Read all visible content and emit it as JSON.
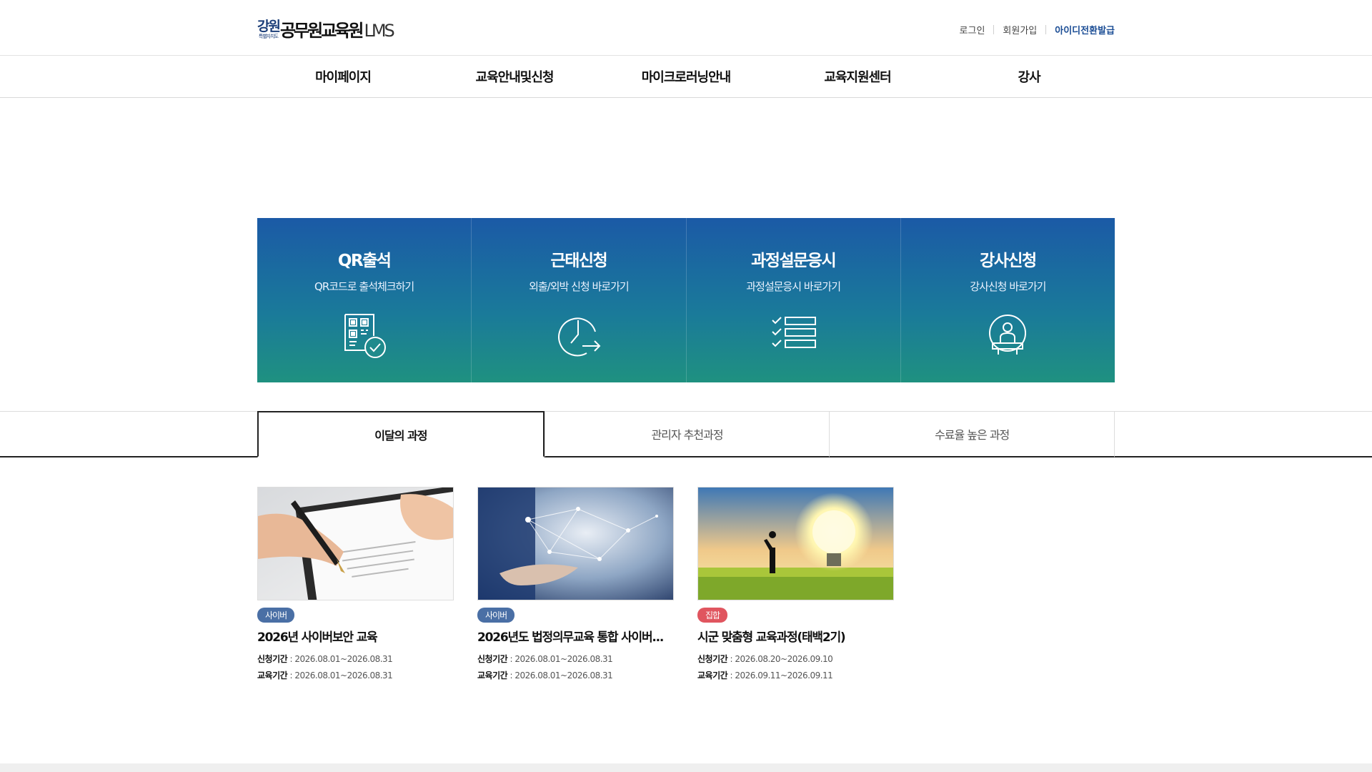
{
  "header": {
    "logo": {
      "seal_main": "강원",
      "seal_sub": "특별자치도",
      "name": "공무원교육원",
      "suffix": "LMS"
    },
    "util": {
      "login": "로그인",
      "join": "회원가입",
      "id_convert": "아이디전환발급"
    }
  },
  "gnb": [
    "마이페이지",
    "교육안내및신청",
    "마이크로러닝안내",
    "교육지원센터",
    "강사"
  ],
  "quick": [
    {
      "title": "QR출석",
      "sub": "QR코드로 출석체크하기",
      "icon": "qr-check-icon"
    },
    {
      "title": "근태신청",
      "sub": "외출/외박 신청 바로가기",
      "icon": "clock-arrow-icon"
    },
    {
      "title": "과정설문응시",
      "sub": "과정설문응시 바로가기",
      "icon": "checklist-icon"
    },
    {
      "title": "강사신청",
      "sub": "강사신청 바로가기",
      "icon": "lecturer-icon"
    }
  ],
  "tabs": [
    "이달의 과정",
    "관리자 추천과정",
    "수료율 높은 과정"
  ],
  "courses": [
    {
      "badge": "사이버",
      "title": "2026년 사이버보안 교육",
      "apply_label": "신청기간",
      "apply": " : 2026.08.01~2026.08.31",
      "edu_label": "교육기간",
      "edu": " : 2026.08.01~2026.08.31"
    },
    {
      "badge": "사이버",
      "title": "2026년도 법정의무교육 통합 사이버...",
      "apply_label": "신청기간",
      "apply": " : 2026.08.01~2026.08.31",
      "edu_label": "교육기간",
      "edu": " : 2026.08.01~2026.08.31"
    },
    {
      "badge": "집합",
      "title": "시군 맞춤형 교육과정(태백2기)",
      "apply_label": "신청기간",
      "apply": " : 2026.08.20~2026.09.10",
      "edu_label": "교육기간",
      "edu": " : 2026.09.11~2026.09.11"
    }
  ],
  "colors": {
    "brand": "#1c3e79",
    "banner_top": "#1b5aa6",
    "banner_bottom": "#1f9180",
    "badge_cyber": "#4a6fa5",
    "badge_group": "#e0555f",
    "link_strong": "#1b4d95"
  }
}
